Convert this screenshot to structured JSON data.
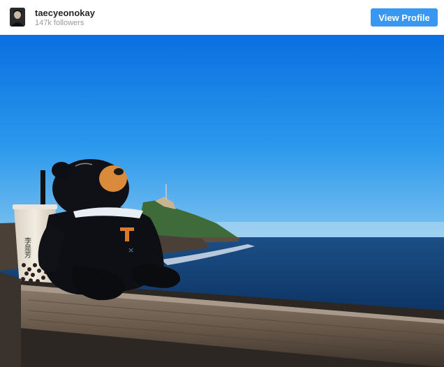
{
  "profile": {
    "username": "taecyeonokay",
    "followers": "147k followers",
    "avatar_icon": "profile-photo-avatar"
  },
  "actions": {
    "view_profile_label": "View Profile"
  },
  "colors": {
    "button": "#3897f0",
    "username": "#262626",
    "followers": "#9a9a9a"
  },
  "photo": {
    "cup_text": "李是芳"
  }
}
